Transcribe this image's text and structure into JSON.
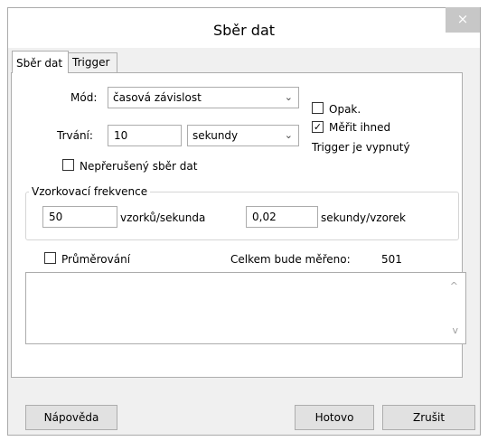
{
  "window": {
    "title": "Sběr dat"
  },
  "tabs": [
    {
      "label": "Sběr dat"
    },
    {
      "label": "Trigger"
    }
  ],
  "mode": {
    "label": "Mód:",
    "value": "časová závislost"
  },
  "duration": {
    "label": "Trvání:",
    "value": "10",
    "unit": "sekundy"
  },
  "options": {
    "repeat": {
      "label": "Opak.",
      "checked": false
    },
    "measure_now": {
      "label": "Měřit ihned",
      "checked": true
    },
    "trigger_status": "Trigger je vypnutý",
    "continuous": {
      "label": "Nepřerušený sběr dat",
      "checked": false
    }
  },
  "sampling": {
    "title": "Vzorkovací frekvence",
    "rate_value": "50",
    "rate_unit": "vzorků/sekunda",
    "interval_value": "0,02",
    "interval_unit": "sekundy/vzorek"
  },
  "averaging": {
    "label": "Průměrování",
    "checked": false
  },
  "total": {
    "label": "Celkem bude měřeno:",
    "value": "501"
  },
  "buttons": {
    "help": "Nápověda",
    "done": "Hotovo",
    "cancel": "Zrušit"
  },
  "icons": {
    "close": "×",
    "chevron": "⌄",
    "check": "✓",
    "scroll_up": "^",
    "scroll_down": "v"
  }
}
